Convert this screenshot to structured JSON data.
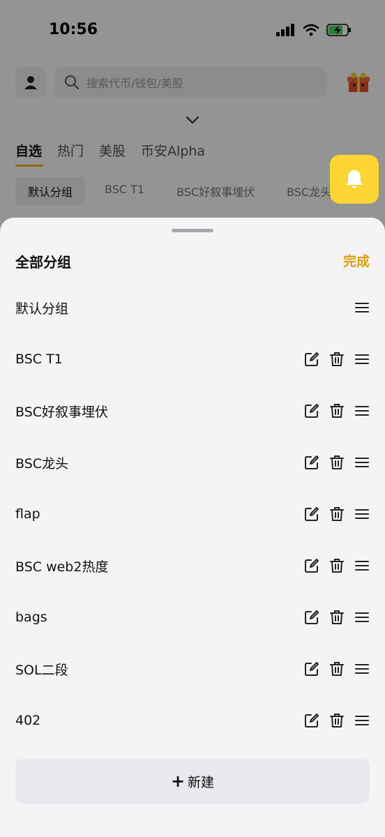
{
  "status_bar": {
    "time": "10:56"
  },
  "search": {
    "placeholder": "搜索代币/钱包/美股"
  },
  "main_tabs": [
    {
      "label": "自选",
      "active": true
    },
    {
      "label": "热门",
      "active": false
    },
    {
      "label": "美股",
      "active": false
    },
    {
      "label": "币安Alpha",
      "active": false
    }
  ],
  "sub_tabs": [
    {
      "label": "默认分组",
      "active": true
    },
    {
      "label": "BSC T1",
      "active": false
    },
    {
      "label": "BSC好叙事埋伏",
      "active": false
    },
    {
      "label": "BSC龙头",
      "active": false
    }
  ],
  "sheet": {
    "title": "全部分组",
    "done_label": "完成",
    "groups": [
      {
        "name": "默认分组",
        "editable": false
      },
      {
        "name": "BSC T1",
        "editable": true
      },
      {
        "name": "BSC好叙事埋伏",
        "editable": true
      },
      {
        "name": "BSC龙头",
        "editable": true
      },
      {
        "name": "flap",
        "editable": true
      },
      {
        "name": "BSC web2热度",
        "editable": true
      },
      {
        "name": "bags",
        "editable": true
      },
      {
        "name": "SOL二段",
        "editable": true
      },
      {
        "name": "402",
        "editable": true
      }
    ],
    "new_plus": "+",
    "new_label": "新建"
  },
  "icons": {
    "bell": "bell-icon",
    "edit": "edit-icon",
    "delete": "trash-icon",
    "drag": "drag-handle-icon"
  },
  "colors": {
    "accent": "#f0b90b",
    "bell_bg": "#fcd535",
    "done_text": "#d9a008",
    "sheet_bg": "#f4f4f6"
  }
}
